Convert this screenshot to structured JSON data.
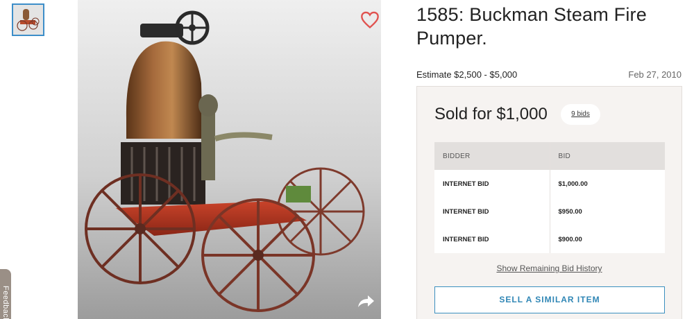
{
  "gallery": {
    "thumbnail_alt": "Buckman Steam Fire Pumper thumbnail"
  },
  "feedback": {
    "label": "Feedback"
  },
  "lot": {
    "title": "1585: Buckman Steam Fire Pumper.",
    "estimate": "Estimate $2,500 - $5,000",
    "date": "Feb 27, 2010"
  },
  "sale": {
    "sold_text": "Sold for $1,000",
    "bids_count": "9 bids",
    "table": {
      "headers": [
        "BIDDER",
        "BID"
      ],
      "rows": [
        {
          "bidder": "INTERNET BID",
          "bid": "$1,000.00"
        },
        {
          "bidder": "INTERNET BID",
          "bid": "$950.00"
        },
        {
          "bidder": "INTERNET BID",
          "bid": "$900.00"
        }
      ]
    },
    "history_link": "Show Remaining Bid History",
    "sell_button": "SELL A SIMILAR ITEM"
  },
  "icons": {
    "favorite": "heart-icon",
    "share": "share-arrow-icon"
  },
  "colors": {
    "accent_blue": "#2f86b5",
    "heart_red": "#e0524f",
    "panel_bg": "#f6f3f1"
  }
}
